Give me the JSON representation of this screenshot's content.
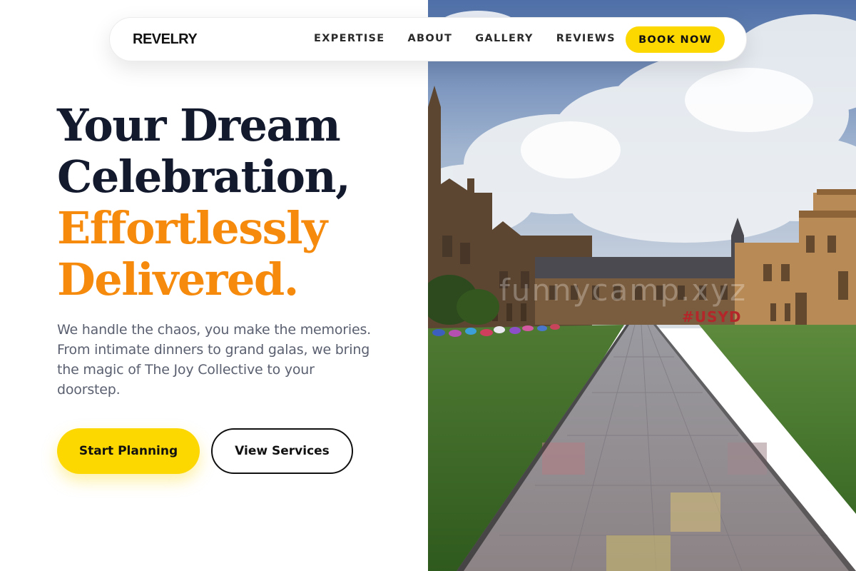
{
  "brand": {
    "name": "REVELRY"
  },
  "nav": {
    "items": [
      {
        "label": "EXPERTISE"
      },
      {
        "label": "ABOUT"
      },
      {
        "label": "GALLERY"
      },
      {
        "label": "REVIEWS"
      }
    ],
    "cta_label": "BOOK NOW"
  },
  "hero": {
    "headline_lines": [
      "Your Dream",
      "Celebration,"
    ],
    "headline_accent_lines": [
      "Effortlessly",
      "Delivered."
    ],
    "subtitle": "We handle the chaos, you make the memories. From intimate dinners to grand galas, we bring the magic of The Joy Collective to your doorstep.",
    "primary_button": "Start Planning",
    "secondary_button": "View Services"
  },
  "photo": {
    "watermark": "funnycamp.xyz",
    "sign_text": "#USYD"
  },
  "colors": {
    "accent_yellow": "#fdd700",
    "accent_orange": "#f58a0c",
    "heading_dark": "#131a2e",
    "body_text": "#5b6070"
  }
}
